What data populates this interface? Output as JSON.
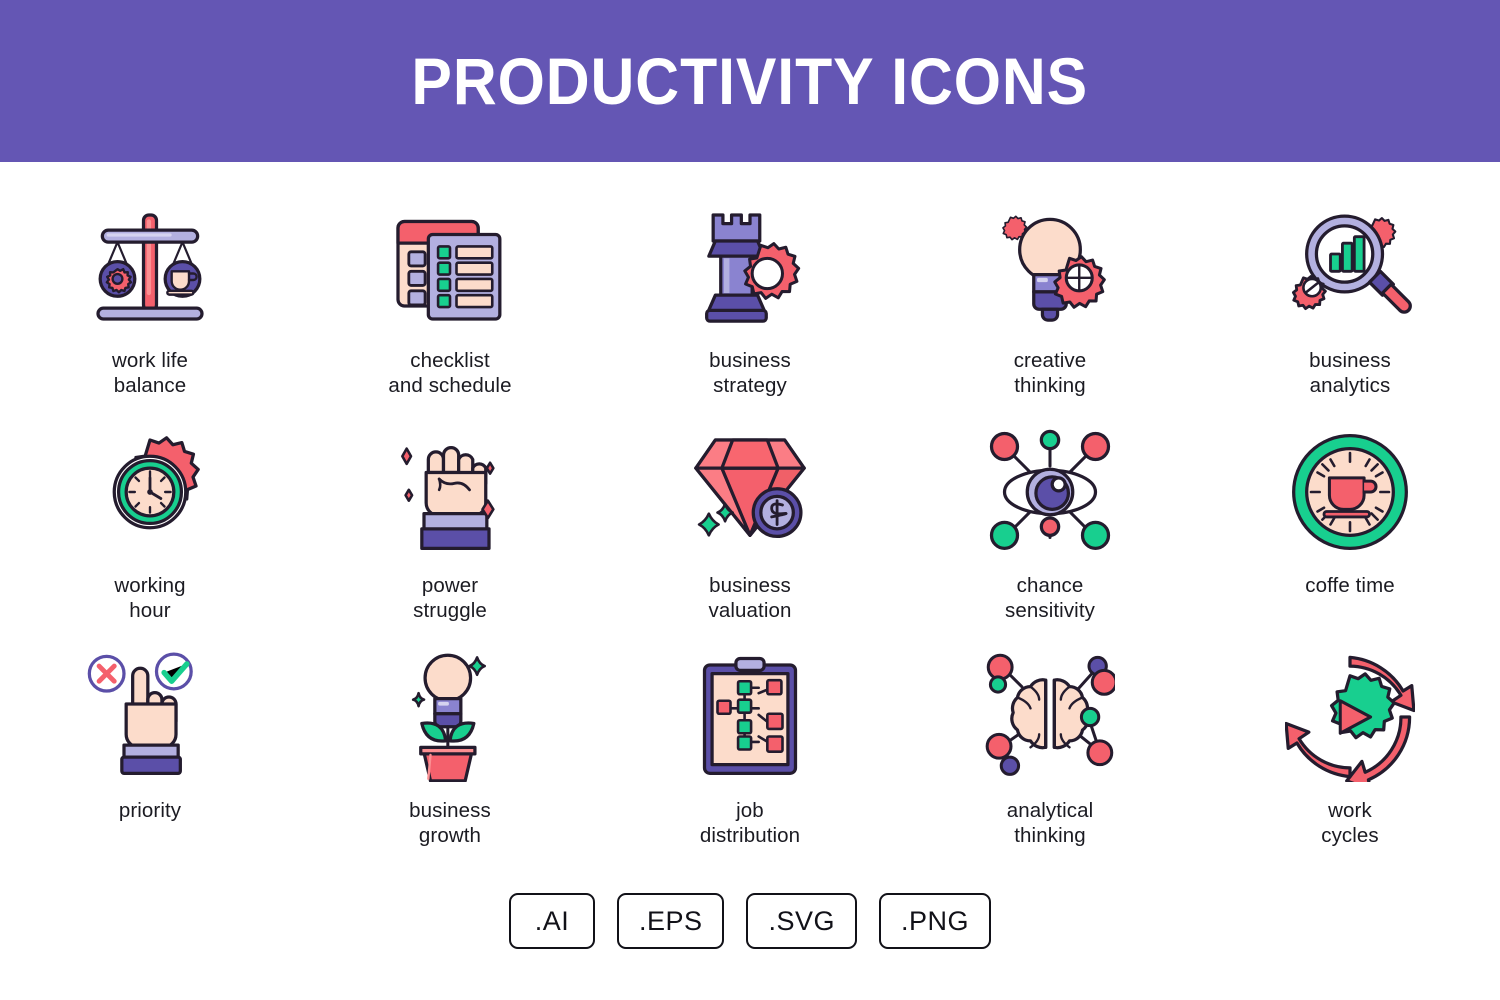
{
  "header": {
    "title": "PRODUCTIVITY ICONS",
    "background_color": "#6456b4",
    "text_color": "#ffffff"
  },
  "palette": {
    "purple_banner": "#6456b4",
    "light_purple": "#b3b0e0",
    "deep_purple": "#5b4fa8",
    "coral_red": "#f4606c",
    "light_peach": "#fcdccb",
    "green": "#18cf8f",
    "outline": "#241c2e",
    "white": "#ffffff",
    "label_text": "#1b1b22"
  },
  "icons": [
    {
      "id": "work-life-balance",
      "label": "work life\nbalance",
      "art": "balance-scale-icon"
    },
    {
      "id": "checklist-schedule",
      "label": "checklist\nand schedule",
      "art": "calendar-checklist-icon"
    },
    {
      "id": "business-strategy",
      "label": "business\nstrategy",
      "art": "chess-rook-gear-icon"
    },
    {
      "id": "creative-thinking",
      "label": "creative\nthinking",
      "art": "lightbulb-gear-icon"
    },
    {
      "id": "business-analytics",
      "label": "business\nanalytics",
      "art": "magnifier-chart-icon"
    },
    {
      "id": "working-hour",
      "label": "working\nhour",
      "art": "gear-clock-icon"
    },
    {
      "id": "power-struggle",
      "label": "power\nstruggle",
      "art": "raised-fist-icon"
    },
    {
      "id": "business-valuation",
      "label": "business\nvaluation",
      "art": "diamond-coin-icon"
    },
    {
      "id": "chance-sensitivity",
      "label": "chance\nsensitivity",
      "art": "eye-network-icon"
    },
    {
      "id": "coffe-time",
      "label": "coffe time",
      "art": "clock-coffee-icon"
    },
    {
      "id": "priority",
      "label": "priority",
      "art": "pointing-hand-choice-icon"
    },
    {
      "id": "business-growth",
      "label": "business\ngrowth",
      "art": "lightbulb-plant-icon"
    },
    {
      "id": "job-distribution",
      "label": "job\ndistribution",
      "art": "clipboard-flowchart-icon"
    },
    {
      "id": "analytical-thinking",
      "label": "analytical\nthinking",
      "art": "brain-network-icon"
    },
    {
      "id": "work-cycles",
      "label": "work\ncycles",
      "art": "gear-play-cycle-icon"
    }
  ],
  "formats": [
    {
      "id": "ai",
      "label": ".AI"
    },
    {
      "id": "eps",
      "label": ".EPS"
    },
    {
      "id": "svg",
      "label": ".SVG"
    },
    {
      "id": "png",
      "label": ".PNG"
    }
  ]
}
